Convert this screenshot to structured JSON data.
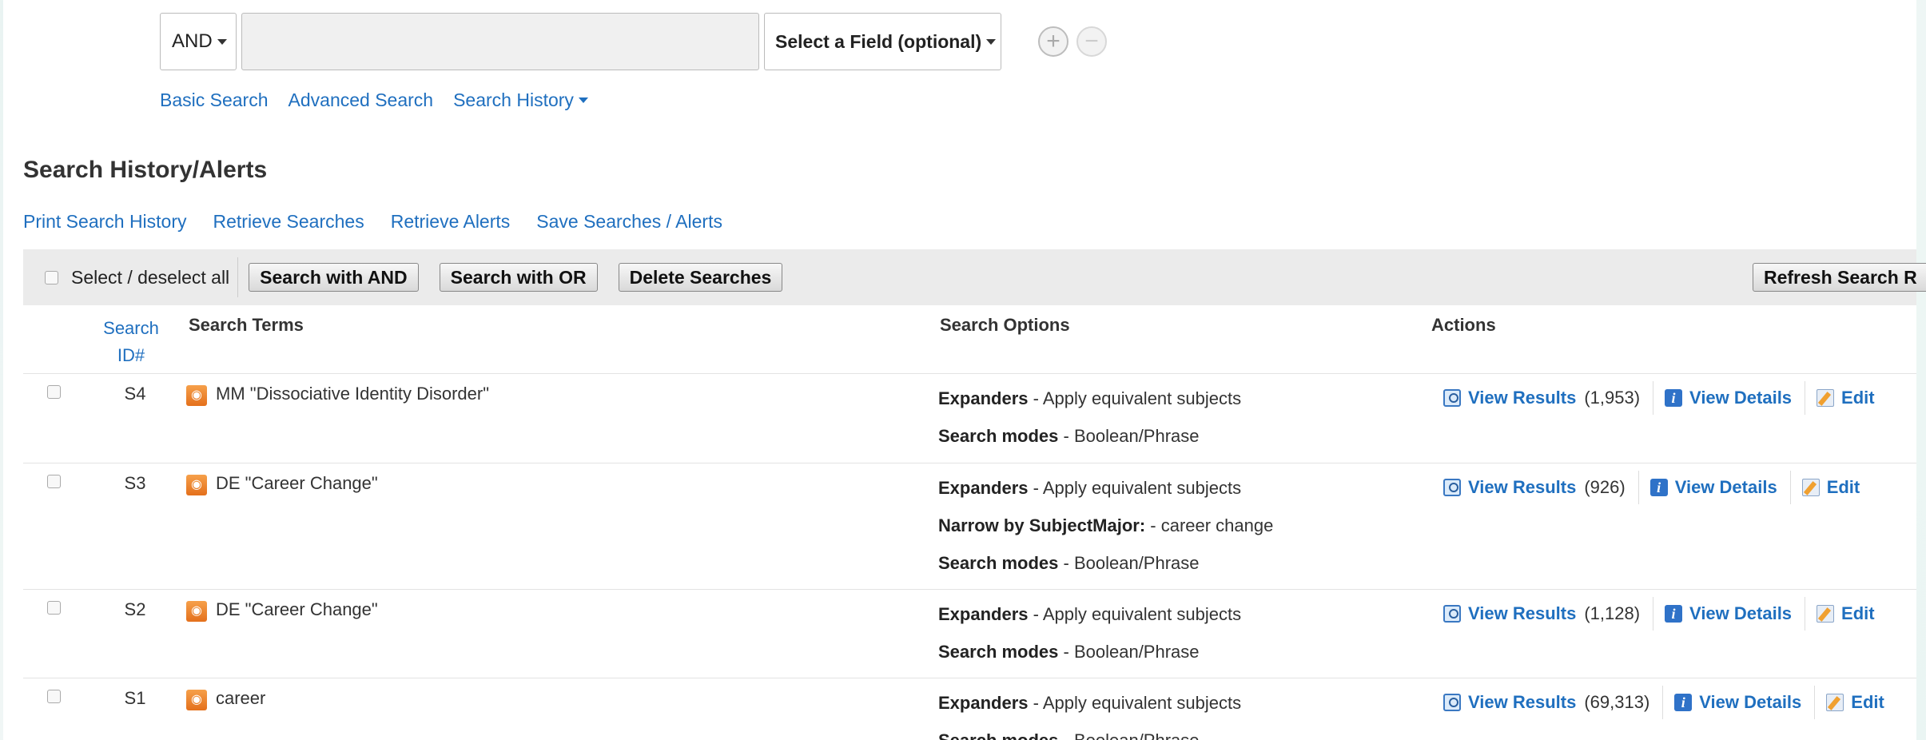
{
  "search": {
    "bool_operator": "AND",
    "query_value": "",
    "field_select": "Select a Field (optional)",
    "add_row": "+",
    "remove_row": "−"
  },
  "search_links": {
    "basic": "Basic Search",
    "advanced": "Advanced Search",
    "history": "Search History"
  },
  "page_title": "Search History/Alerts",
  "history_links": [
    "Print Search History",
    "Retrieve Searches",
    "Retrieve Alerts",
    "Save Searches / Alerts"
  ],
  "toolbar": {
    "select_all": "Select / deselect all",
    "search_and": "Search with AND",
    "search_or": "Search with OR",
    "delete": "Delete Searches",
    "refresh": "Refresh Search R"
  },
  "columns": {
    "search_id": "Search ID#",
    "terms": "Search Terms",
    "options": "Search Options",
    "actions": "Actions"
  },
  "action_labels": {
    "view_results": "View Results",
    "view_details": "View Details",
    "edit": "Edit"
  },
  "rows": [
    {
      "id": "S4",
      "term": "MM \"Dissociative Identity Disorder\"",
      "options": [
        {
          "label": "Expanders",
          "value": " - Apply equivalent subjects"
        },
        {
          "label": "Search modes",
          "value": " - Boolean/Phrase"
        }
      ],
      "count": "(1,953)"
    },
    {
      "id": "S3",
      "term": "DE \"Career Change\"",
      "options": [
        {
          "label": "Expanders",
          "value": " - Apply equivalent subjects"
        },
        {
          "label": "Narrow by SubjectMajor:",
          "value": " - career change"
        },
        {
          "label": "Search modes",
          "value": " - Boolean/Phrase"
        }
      ],
      "count": "(926)"
    },
    {
      "id": "S2",
      "term": "DE \"Career Change\"",
      "options": [
        {
          "label": "Expanders",
          "value": " - Apply equivalent subjects"
        },
        {
          "label": "Search modes",
          "value": " - Boolean/Phrase"
        }
      ],
      "count": "(1,128)"
    },
    {
      "id": "S1",
      "term": "career",
      "options": [
        {
          "label": "Expanders",
          "value": " - Apply equivalent subjects"
        },
        {
          "label": "Search modes",
          "value": " - Boolean/Phrase"
        }
      ],
      "count": "(69,313)"
    }
  ],
  "colors": {
    "link": "#1f6fbf",
    "toolbar_bg": "#ebebeb",
    "rss_icon": "#e4701c"
  }
}
